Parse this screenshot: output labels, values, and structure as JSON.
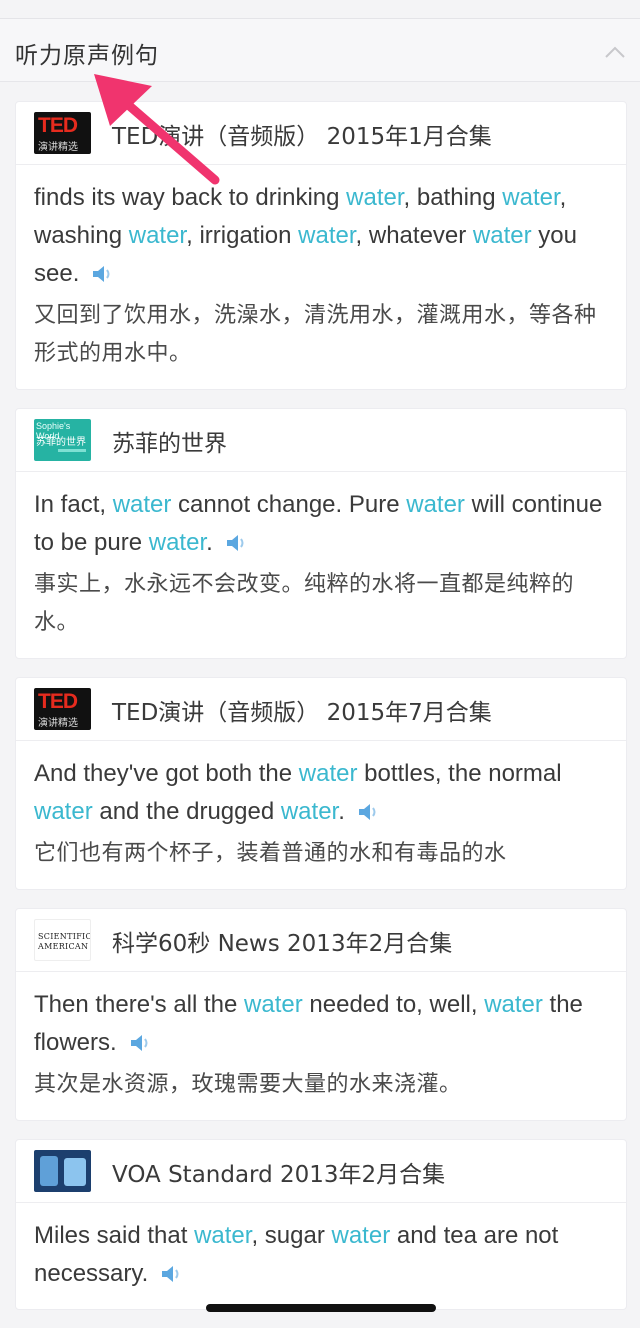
{
  "section": {
    "title": "听力原声例句",
    "collapse_icon": "chevron-up-icon"
  },
  "colors": {
    "highlight": "#3bb8cf",
    "speaker": "#5ba7e0",
    "arrow": "#f0346e"
  },
  "examples": [
    {
      "source": "TED演讲（音频版） 2015年1月合集",
      "thumb": {
        "type": "ted",
        "l1": "TED",
        "l2": "演讲精选"
      },
      "en": [
        {
          "t": "finds its way back to drinking "
        },
        {
          "t": "water",
          "hl": true
        },
        {
          "t": ", bathing "
        },
        {
          "t": "water",
          "hl": true
        },
        {
          "t": ", washing "
        },
        {
          "t": "water",
          "hl": true
        },
        {
          "t": ", irrigation "
        },
        {
          "t": "water",
          "hl": true
        },
        {
          "t": ", whatever "
        },
        {
          "t": "water",
          "hl": true
        },
        {
          "t": " you see."
        }
      ],
      "zh": "又回到了饮用水，洗澡水，清洗用水，灌溉用水，等各种形式的用水中。"
    },
    {
      "source": "苏菲的世界",
      "thumb": {
        "type": "sophie",
        "l1": "Sophie's World",
        "l2": "苏菲的世界"
      },
      "en": [
        {
          "t": "In fact, "
        },
        {
          "t": "water",
          "hl": true
        },
        {
          "t": " cannot change. Pure "
        },
        {
          "t": "water",
          "hl": true
        },
        {
          "t": " will continue to be pure "
        },
        {
          "t": "water",
          "hl": true
        },
        {
          "t": "."
        }
      ],
      "zh": "事实上，水永远不会改变。纯粹的水将一直都是纯粹的水。"
    },
    {
      "source": "TED演讲（音频版） 2015年7月合集",
      "thumb": {
        "type": "ted",
        "l1": "TED",
        "l2": "演讲精选"
      },
      "en": [
        {
          "t": "And they've got both the "
        },
        {
          "t": "water",
          "hl": true
        },
        {
          "t": " bottles, the normal "
        },
        {
          "t": "water",
          "hl": true
        },
        {
          "t": " and the drugged "
        },
        {
          "t": "water",
          "hl": true
        },
        {
          "t": "."
        }
      ],
      "zh": "它们也有两个杯子，装着普通的水和有毒品的水"
    },
    {
      "source": "科学60秒 News 2013年2月合集",
      "thumb": {
        "type": "sciam",
        "l1": "SCIENTIFIC",
        "l2": "AMERICAN"
      },
      "en": [
        {
          "t": "Then there's all the "
        },
        {
          "t": "water",
          "hl": true
        },
        {
          "t": " needed to, well, "
        },
        {
          "t": "water",
          "hl": true
        },
        {
          "t": " the flowers."
        }
      ],
      "zh": "其次是水资源，玫瑰需要大量的水来浇灌。"
    },
    {
      "source": "VOA Standard 2013年2月合集",
      "thumb": {
        "type": "voa",
        "l1": "",
        "l2": ""
      },
      "en": [
        {
          "t": "Miles said that "
        },
        {
          "t": "water",
          "hl": true
        },
        {
          "t": ", sugar "
        },
        {
          "t": "water",
          "hl": true
        },
        {
          "t": " and tea are not necessary."
        }
      ],
      "zh": ""
    }
  ]
}
